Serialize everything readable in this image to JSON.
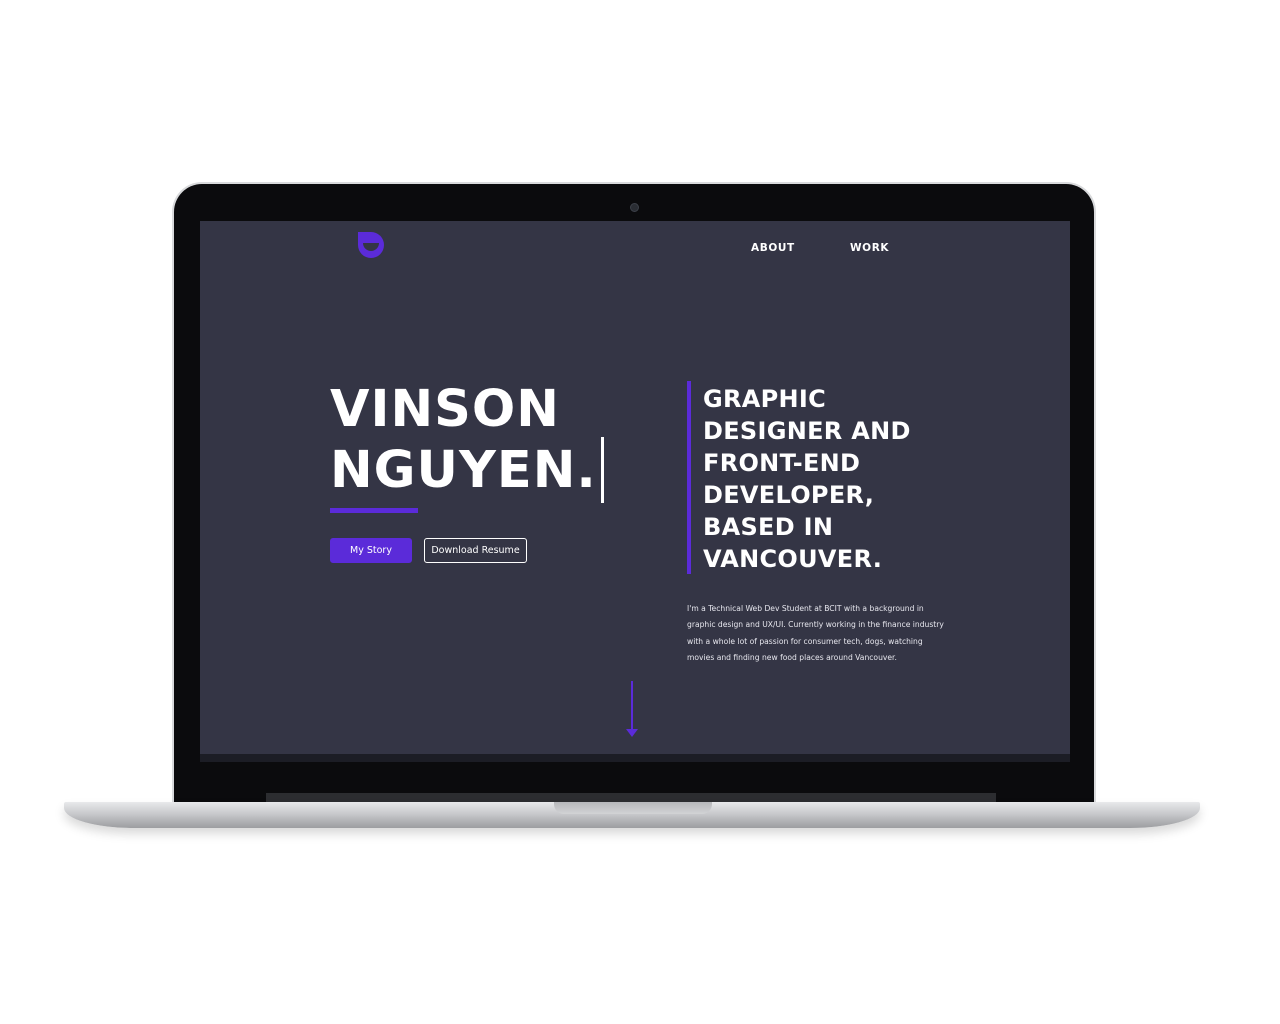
{
  "nav": {
    "items": [
      "ABOUT",
      "WORK"
    ]
  },
  "hero": {
    "name_line_1": "VINSON",
    "name_line_2": "NGUYEN.",
    "tagline": "GRAPHIC DESIGNER AND FRONT-END DEVELOPER, BASED IN VANCOUVER.",
    "bio": "I'm a Technical Web Dev Student at BCIT with a background in graphic design and UX/UI. Currently working in the finance industry with a whole lot of passion for consumer tech, dogs, watching movies and finding new food places around Vancouver.",
    "primary_button": "My Story",
    "secondary_button": "Download Resume"
  },
  "icons": {
    "logo": "smiley-logo-icon",
    "scroll": "arrow-down-icon"
  },
  "colors": {
    "background": "#343545",
    "accent": "#5b2bd9",
    "text": "#ffffff",
    "laptop_bezel": "#0b0b0d",
    "laptop_body": "#c8c9cc"
  }
}
